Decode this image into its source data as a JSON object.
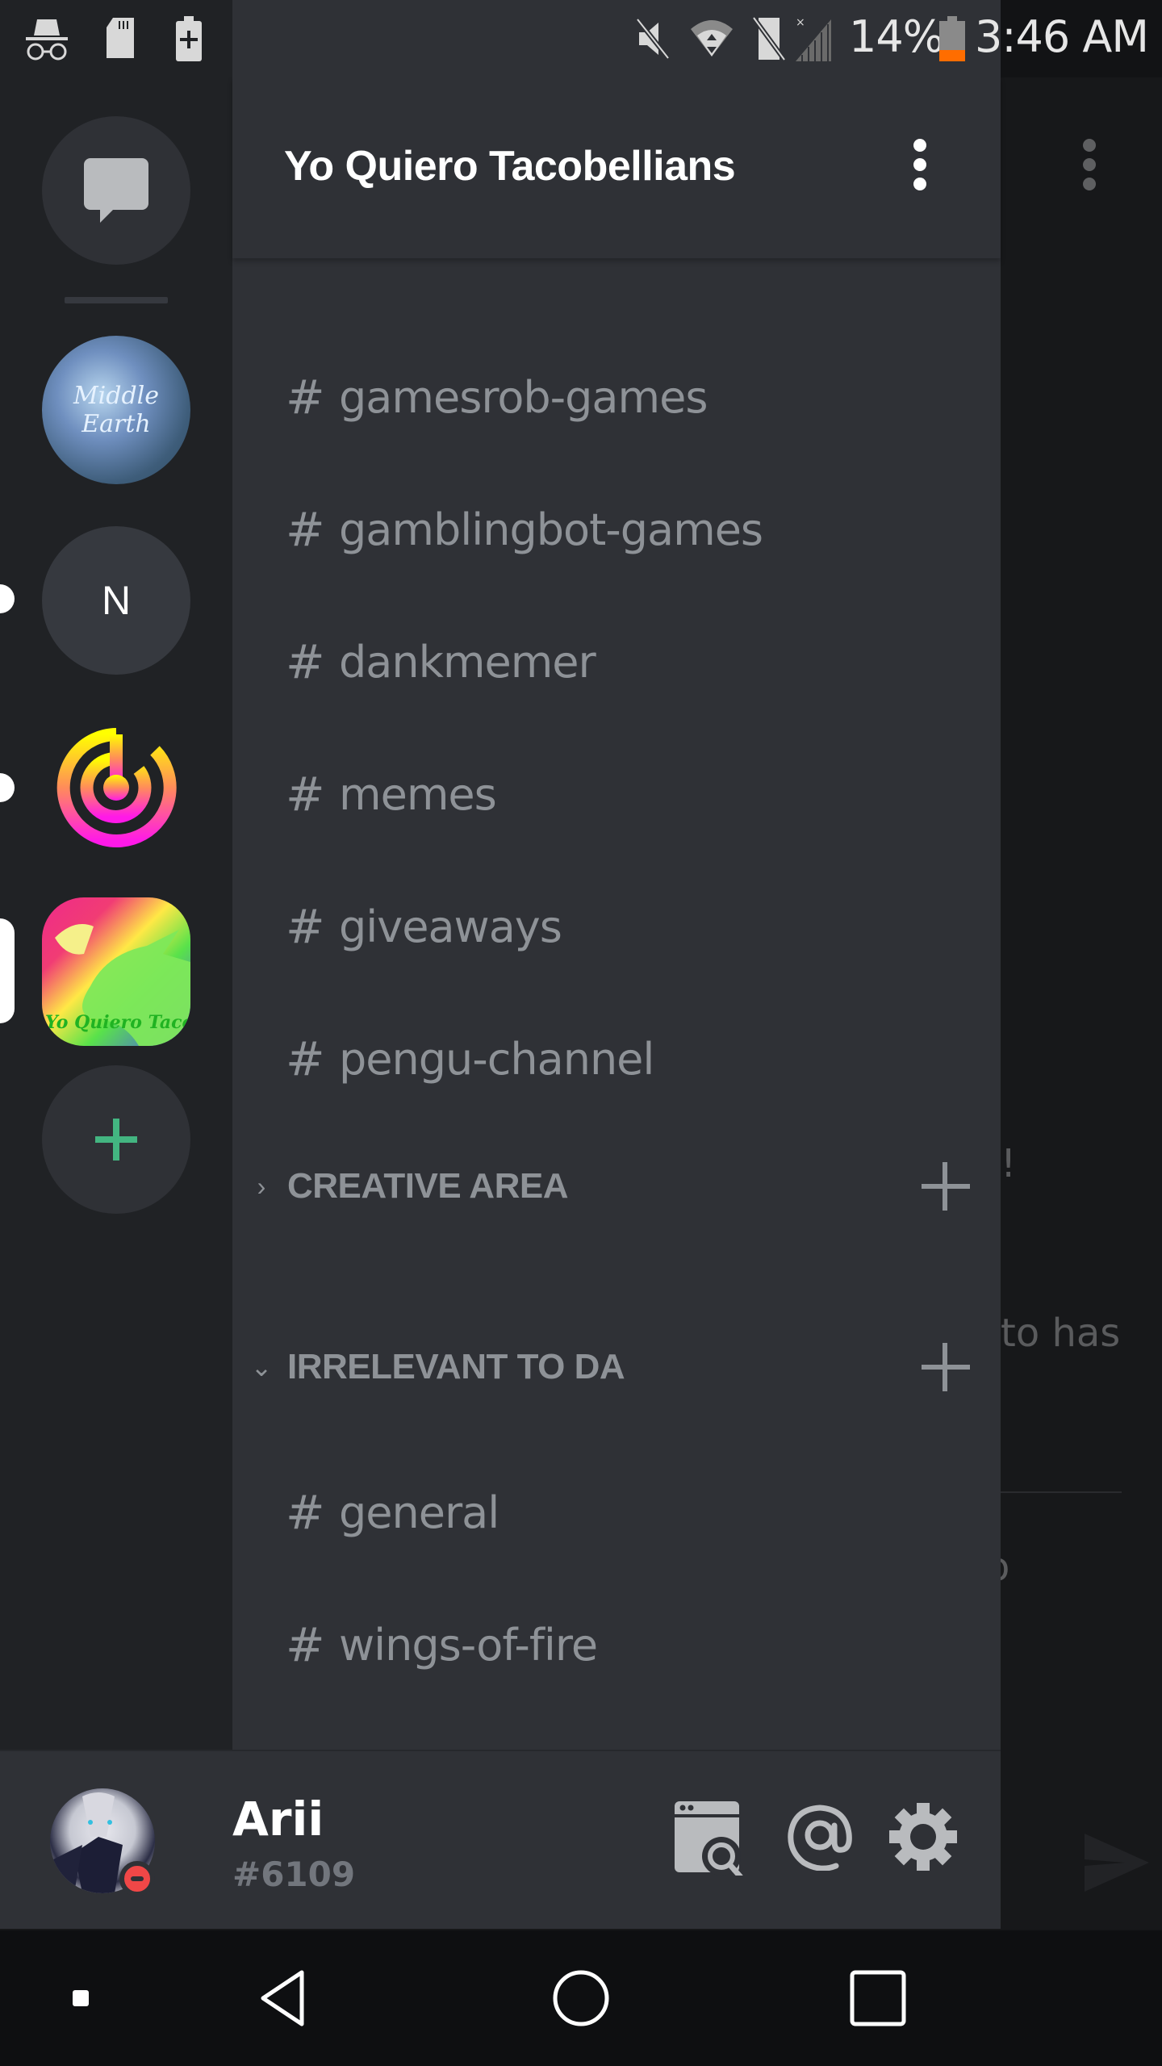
{
  "status_bar": {
    "battery_percent": "14%",
    "time": "3:46 AM",
    "icons_left": [
      "incognito-icon",
      "sd-card-icon",
      "battery-saver-icon"
    ],
    "icons_right": [
      "mute-icon",
      "wifi-icon",
      "no-sim-icon",
      "signal-icon",
      "battery-icon"
    ],
    "battery_color": "#ff6d00"
  },
  "guild_rail": {
    "dm_label": "Direct Messages",
    "guilds": [
      {
        "name": "Middle Earth",
        "image_text": "Middle Earth"
      },
      {
        "name": "N",
        "initial": "N",
        "unread": true
      },
      {
        "name": "Radar server",
        "unread": true
      },
      {
        "name": "Yo Quiero Tacobellians",
        "image_text": "Yo Quiero Tacobellians",
        "selected": true
      }
    ],
    "add_server_label": "Add a Server",
    "add_color": "#43b581"
  },
  "drawer": {
    "server_name": "Yo Quiero Tacobellians",
    "channels_top": [
      {
        "name": "gamesrob-games"
      },
      {
        "name": "gamblingbot-games"
      },
      {
        "name": "dankmemer"
      },
      {
        "name": "memes"
      },
      {
        "name": "giveaways"
      },
      {
        "name": "pengu-channel"
      }
    ],
    "categories": [
      {
        "label": "CREATIVE AREA",
        "collapsed": true,
        "channels": []
      },
      {
        "label": "IRRELEVANT TO DA",
        "collapsed": false,
        "channels": [
          {
            "name": "general"
          },
          {
            "name": "wings-of-fire"
          }
        ]
      }
    ],
    "hash_symbol": "#"
  },
  "background_chat": {
    "peek_texts": [
      "!",
      "to has",
      "o"
    ]
  },
  "user_panel": {
    "username": "Arii",
    "discriminator": "#6109",
    "status": "do-not-disturb",
    "status_color": "#f04747",
    "buttons": [
      "search-icon",
      "mentions-icon",
      "settings-icon"
    ]
  },
  "nav_bar": {
    "buttons": [
      "indicator",
      "back",
      "home",
      "recents"
    ]
  }
}
